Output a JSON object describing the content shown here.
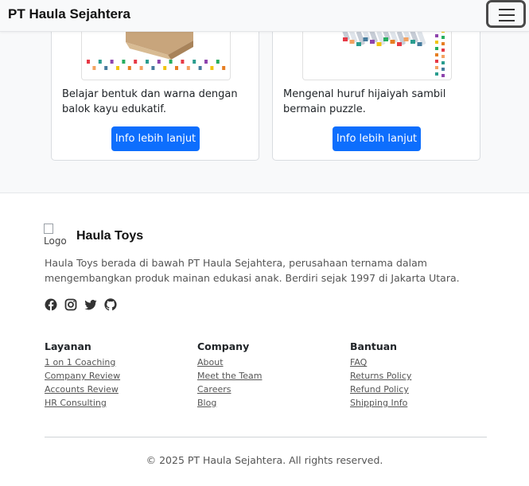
{
  "navbar": {
    "brand": "PT Haula Sejahtera",
    "toggle_icon": "hamburger-icon"
  },
  "products": [
    {
      "description": "Belajar bentuk dan warna dengan balok kayu edukatif.",
      "button_label": "Info lebih lanjut"
    },
    {
      "description": "Mengenal huruf hijaiyah sambil bermain puzzle.",
      "button_label": "Info lebih lanjut"
    }
  ],
  "footer": {
    "logo_alt": "Logo",
    "title": "Haula Toys",
    "description": "Haula Toys berada di bawah PT Haula Sejahtera, perusahaan ternama dalam mengembangkan produk mainan edukasi anak. Berdiri sejak 1997 di Jakarta Utara.",
    "social_icons": [
      "facebook-icon",
      "instagram-icon",
      "twitter-icon",
      "github-icon"
    ],
    "columns": [
      {
        "heading": "Layanan",
        "links": [
          "1 on 1 Coaching",
          "Company Review",
          "Accounts Review",
          "HR Consulting"
        ]
      },
      {
        "heading": "Company",
        "links": [
          "About",
          "Meet the Team",
          "Careers",
          "Blog"
        ]
      },
      {
        "heading": "Bantuan",
        "links": [
          "FAQ",
          "Returns Policy",
          "Refund Policy",
          "Shipping Info"
        ]
      }
    ],
    "copyright": "© 2025 PT Haula Sejahtera. All rights reserved."
  },
  "colors": {
    "primary": "#0d6efd",
    "navbar_bg": "#f8f9fa",
    "text_muted": "#555555"
  }
}
